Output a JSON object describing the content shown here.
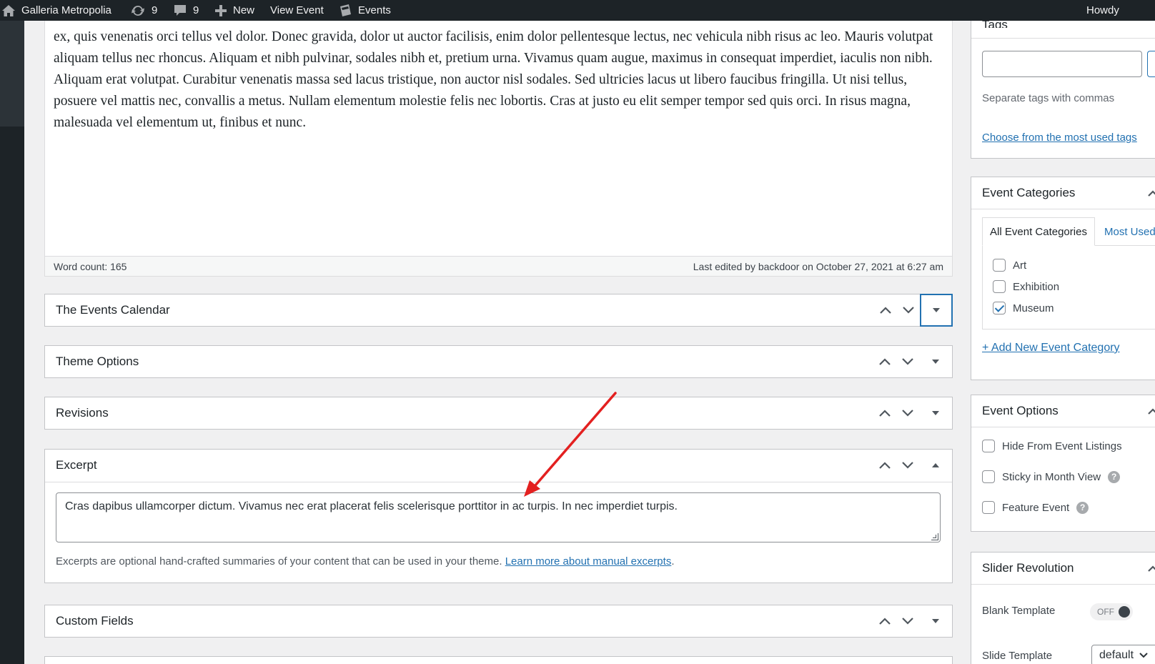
{
  "adminbar": {
    "site_name": "Galleria Metropolia",
    "updates_count": "9",
    "comments_count": "9",
    "new_label": "New",
    "view_label": "View Event",
    "events_label": "Events",
    "howdy_label": "Howdy"
  },
  "editor": {
    "content": "ex, quis venenatis orci tellus vel dolor. Donec gravida, dolor ut auctor facilisis, enim dolor pellentesque lectus, nec vehicula nibh risus ac leo. Mauris volutpat aliquam tellus nec rhoncus. Aliquam et nibh pulvinar, sodales nibh et, pretium urna. Vivamus quam augue, maximus in consequat imperdiet, iaculis non nibh. Aliquam erat volutpat. Curabitur venenatis massa sed lacus tristique, non auctor nisl sodales. Sed ultricies lacus ut libero faucibus fringilla. Ut nisi tellus, posuere vel mattis nec, convallis a metus. Nullam elementum molestie felis nec lobortis. Cras at justo eu elit semper tempor sed quis orci. In risus magna, malesuada vel elementum ut, finibus et nunc.",
    "word_count": "Word count: 165",
    "last_edited": "Last edited by backdoor on October 27, 2021 at 6:27 am"
  },
  "postboxes": {
    "events_calendar": "The Events Calendar",
    "theme_options": "Theme Options",
    "revisions": "Revisions",
    "excerpt": "Excerpt",
    "custom_fields": "Custom Fields"
  },
  "excerpt": {
    "value": "Cras dapibus ullamcorper dictum. Vivamus nec erat placerat felis scelerisque porttitor in ac turpis. In nec imperdiet turpis.",
    "help_text": "Excerpts are optional hand-crafted summaries of your content that can be used in your theme. ",
    "help_link": "Learn more about manual excerpts",
    "help_end": "."
  },
  "tags": {
    "title": "Tags",
    "help": "Separate tags with commas",
    "choose_link": "Choose from the most used tags"
  },
  "event_categories": {
    "title": "Event Categories",
    "tab_all": "All Event Categories",
    "tab_most_used": "Most Used",
    "items": [
      {
        "label": "Art",
        "checked": false
      },
      {
        "label": "Exhibition",
        "checked": false
      },
      {
        "label": "Museum",
        "checked": true
      }
    ],
    "add_new": "+ Add New Event Category"
  },
  "event_options": {
    "title": "Event Options",
    "hide": "Hide From Event Listings",
    "sticky": "Sticky in Month View",
    "feature": "Feature Event"
  },
  "slider_revolution": {
    "title": "Slider Revolution",
    "blank_template": "Blank Template",
    "toggle_state": "OFF",
    "slide_template": "Slide Template",
    "slide_template_value": "default"
  },
  "colors": {
    "adminbar": "#1d2327",
    "link": "#2271b1",
    "annotation": "#e32020"
  }
}
